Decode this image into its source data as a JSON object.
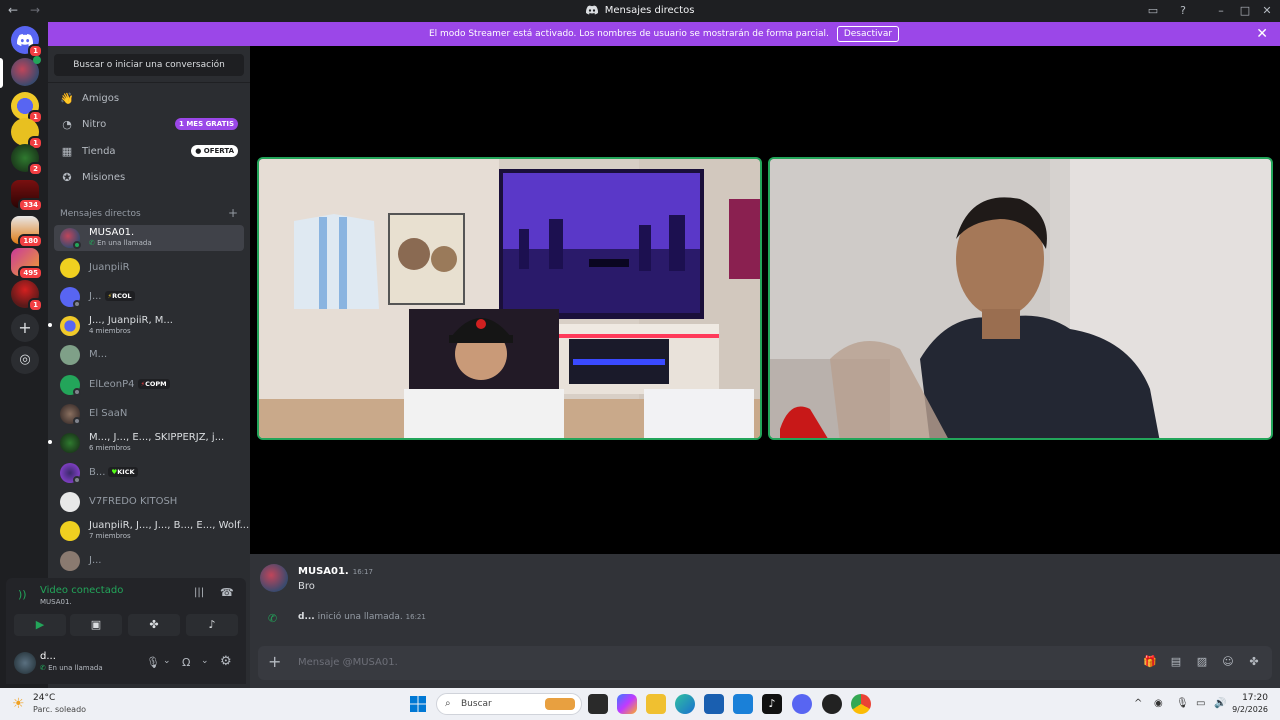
{
  "titlebar": {
    "title": "Mensajes directos",
    "back": "←",
    "forward": "→"
  },
  "banner": {
    "text": "El modo Streamer está activado. Los nombres de usuario se mostrarán de forma parcial.",
    "button": "Desactivar"
  },
  "guilds": [
    {
      "badge": "1"
    },
    {
      "badge": ""
    },
    {
      "badge": "1"
    },
    {
      "badge": "1"
    },
    {
      "badge": "2"
    },
    {
      "badge": "334"
    },
    {
      "badge": "180"
    },
    {
      "badge": "495"
    },
    {
      "badge": "1"
    }
  ],
  "sidebar": {
    "search": "Buscar o iniciar una conversación",
    "nav": [
      {
        "label": "Amigos",
        "tag": ""
      },
      {
        "label": "Nitro",
        "tag": "1 MES GRATIS"
      },
      {
        "label": "Tienda",
        "tag": "OFERTA"
      },
      {
        "label": "Misiones",
        "tag": ""
      }
    ],
    "dm_header": "Mensajes directos",
    "dms": [
      {
        "name": "MUSA01.",
        "sub": "En una llamada",
        "tag": ""
      },
      {
        "name": "JuanpiiR",
        "sub": "",
        "tag": ""
      },
      {
        "name": "J...",
        "sub": "",
        "tag": "RCOL"
      },
      {
        "name": "J..., JuanpiiR, M...",
        "sub": "4 miembros",
        "tag": ""
      },
      {
        "name": "M...",
        "sub": "",
        "tag": ""
      },
      {
        "name": "ElLeonP4",
        "sub": "",
        "tag": "COPM"
      },
      {
        "name": "El SaaN",
        "sub": "",
        "tag": ""
      },
      {
        "name": "M..., J..., E..., SKIPPERJZ, j...",
        "sub": "6 miembros",
        "tag": ""
      },
      {
        "name": "B...",
        "sub": "",
        "tag": "KICK"
      },
      {
        "name": "V7FREDO KITOSH",
        "sub": "",
        "tag": ""
      },
      {
        "name": "JuanpiiR, J..., J..., B..., E..., Wolf...",
        "sub": "7 miembros",
        "tag": ""
      },
      {
        "name": "J...",
        "sub": "",
        "tag": ""
      }
    ]
  },
  "voice": {
    "title": "Video conectado",
    "sub": "MUSA01."
  },
  "user": {
    "name": "d...",
    "status": "En una llamada"
  },
  "chat": {
    "author": "MUSA01.",
    "time": "16:17",
    "text": "Bro",
    "call_user": "d...",
    "call_text": "inició una llamada.",
    "call_time": "16:21",
    "placeholder": "Mensaje @MUSA01."
  },
  "taskbar": {
    "temp": "24°C",
    "weather": "Parc. soleado",
    "search": "Buscar",
    "time": "17:20",
    "date": "9/2/2026"
  }
}
